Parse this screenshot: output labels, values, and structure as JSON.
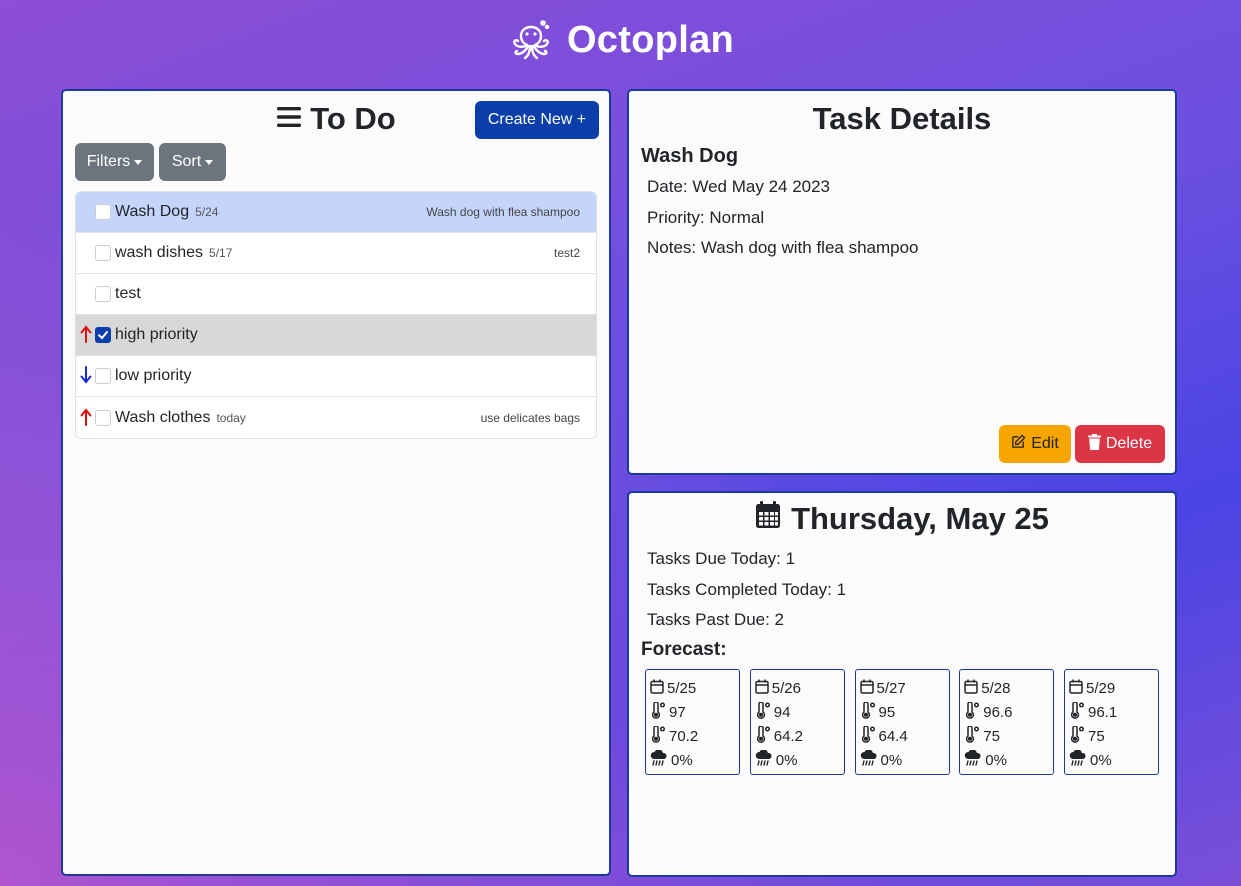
{
  "app": {
    "title": "Octoplan"
  },
  "todo": {
    "title": "To Do",
    "create_label": "Create New +",
    "filters_label": "Filters",
    "sort_label": "Sort",
    "tasks": [
      {
        "name": "Wash Dog",
        "date": "5/24",
        "note": "Wash dog with flea shampoo",
        "priority": "normal",
        "completed": false,
        "selected": true
      },
      {
        "name": "wash dishes",
        "date": "5/17",
        "note": "test2",
        "priority": "normal",
        "completed": false,
        "selected": false
      },
      {
        "name": "test",
        "date": "",
        "note": "",
        "priority": "normal",
        "completed": false,
        "selected": false
      },
      {
        "name": "high priority",
        "date": "",
        "note": "",
        "priority": "high",
        "completed": true,
        "selected": false
      },
      {
        "name": "low priority",
        "date": "",
        "note": "",
        "priority": "low",
        "completed": false,
        "selected": false
      },
      {
        "name": "Wash clothes",
        "date": "today",
        "note": "use delicates bags",
        "priority": "high",
        "completed": false,
        "selected": false
      }
    ]
  },
  "details": {
    "title": "Task Details",
    "name": "Wash Dog",
    "date_line": "Date: Wed May 24 2023",
    "priority_line": "Priority: Normal",
    "notes_line": "Notes: Wash dog with flea shampoo",
    "edit_label": "Edit",
    "delete_label": "Delete"
  },
  "day": {
    "title": "Thursday, May 25",
    "due_today": "Tasks Due Today: 1",
    "completed_today": "Tasks Completed Today: 1",
    "past_due": "Tasks Past Due: 2",
    "forecast_label": "Forecast:",
    "forecast": [
      {
        "date": "5/25",
        "high": "97",
        "low": "70.2",
        "precip": "0%"
      },
      {
        "date": "5/26",
        "high": "94",
        "low": "64.2",
        "precip": "0%"
      },
      {
        "date": "5/27",
        "high": "95",
        "low": "64.4",
        "precip": "0%"
      },
      {
        "date": "5/28",
        "high": "96.6",
        "low": "75",
        "precip": "0%"
      },
      {
        "date": "5/29",
        "high": "96.1",
        "low": "75",
        "precip": "0%"
      }
    ]
  },
  "colors": {
    "primary": "#0a3ea8",
    "secondary": "#6c757d",
    "warning": "#f7a600",
    "danger": "#dc3545",
    "high_priority_arrow": "#e01010",
    "low_priority_arrow": "#1a2bd6",
    "selected_row": "#c5d4fb",
    "completed_row": "#d8d8d8"
  }
}
